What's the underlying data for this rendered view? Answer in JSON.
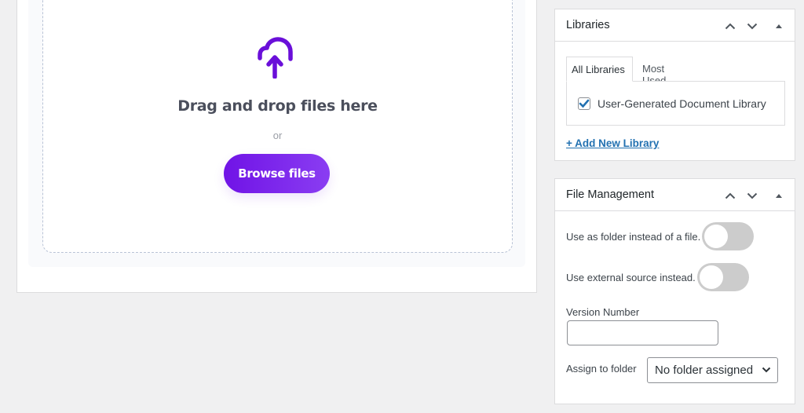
{
  "upload": {
    "icon": "cloud-upload-icon",
    "title": "Drag and drop files here",
    "or": "or",
    "browse_label": "Browse files",
    "accent": "#7013e6"
  },
  "libraries_box": {
    "title": "Libraries",
    "controls": [
      "move-up-icon",
      "move-down-icon",
      "toggle-panel-icon"
    ],
    "tabs": [
      {
        "label": "All Libraries",
        "active": true
      },
      {
        "label": "Most Used",
        "active": false
      }
    ],
    "items": [
      {
        "label": "User-Generated Document Library",
        "checked": true
      }
    ],
    "add_link": "+ Add New Library"
  },
  "file_management": {
    "title": "File Management",
    "controls": [
      "move-up-icon",
      "move-down-icon",
      "toggle-panel-icon"
    ],
    "folder_toggle": {
      "label": "Use as folder instead of a file.",
      "on": false
    },
    "external_toggle": {
      "label": "Use external source instead.",
      "on": false
    },
    "version": {
      "label": "Version Number",
      "value": ""
    },
    "assign": {
      "label": "Assign to folder",
      "selected": "No folder assigned"
    }
  }
}
